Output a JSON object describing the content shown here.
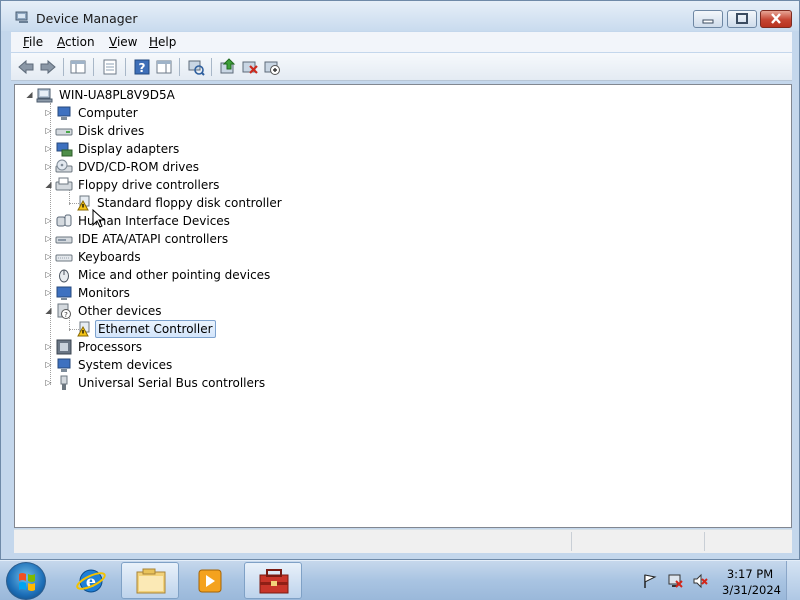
{
  "window": {
    "title": "Device Manager",
    "controls": [
      "minimize",
      "maximize",
      "close"
    ]
  },
  "menu": [
    {
      "label": "File",
      "accel": "F",
      "rest": "ile"
    },
    {
      "label": "Action",
      "accel": "A",
      "rest": "ction"
    },
    {
      "label": "View",
      "accel": "V",
      "rest": "iew"
    },
    {
      "label": "Help",
      "accel": "H",
      "rest": "elp"
    }
  ],
  "toolbar_icons": [
    "back-icon",
    "forward-icon",
    "show-hide-tree-icon",
    "properties-icon",
    "help-icon",
    "action-pane-icon",
    "scan-hardware-icon",
    "update-driver-icon",
    "uninstall-icon",
    "disable-icon"
  ],
  "tree": {
    "root": "WIN-UA8PL8V9D5A",
    "categories": [
      {
        "label": "Computer",
        "icon": "computer-icon",
        "expanded": false
      },
      {
        "label": "Disk drives",
        "icon": "disk-drive-icon",
        "expanded": false
      },
      {
        "label": "Display adapters",
        "icon": "display-adapter-icon",
        "expanded": false
      },
      {
        "label": "DVD/CD-ROM drives",
        "icon": "dvd-drive-icon",
        "expanded": false
      },
      {
        "label": "Floppy drive controllers",
        "icon": "floppy-controller-icon",
        "expanded": true
      },
      {
        "label": "Standard floppy disk controller",
        "icon": "warning-device-icon",
        "child": true
      },
      {
        "label": "Human Interface Devices",
        "icon": "hid-icon",
        "expanded": false
      },
      {
        "label": "IDE ATA/ATAPI controllers",
        "icon": "ide-controller-icon",
        "expanded": false
      },
      {
        "label": "Keyboards",
        "icon": "keyboard-icon",
        "expanded": false
      },
      {
        "label": "Mice and other pointing devices",
        "icon": "mouse-icon",
        "expanded": false
      },
      {
        "label": "Monitors",
        "icon": "monitor-icon",
        "expanded": false
      },
      {
        "label": "Other devices",
        "icon": "other-devices-icon",
        "expanded": true
      },
      {
        "label": "Ethernet Controller",
        "icon": "warning-device-icon",
        "child": true,
        "selected": true
      },
      {
        "label": "Processors",
        "icon": "processor-icon",
        "expanded": false
      },
      {
        "label": "System devices",
        "icon": "system-devices-icon",
        "expanded": false
      },
      {
        "label": "Universal Serial Bus controllers",
        "icon": "usb-icon",
        "expanded": false
      }
    ]
  },
  "taskbar": {
    "apps": [
      "windows-explorer-icon",
      "media-player-icon",
      "device-manager-icon"
    ],
    "browser": "internet-explorer-icon",
    "tray": [
      "action-center-flag-icon",
      "network-icon",
      "volume-muted-icon"
    ],
    "time": "3:17 PM",
    "date": "3/31/2024"
  },
  "colors": {
    "selection_border": "#7da2ce",
    "warning_yellow": "#f5c518",
    "taskbar": "#a9c4e2"
  }
}
